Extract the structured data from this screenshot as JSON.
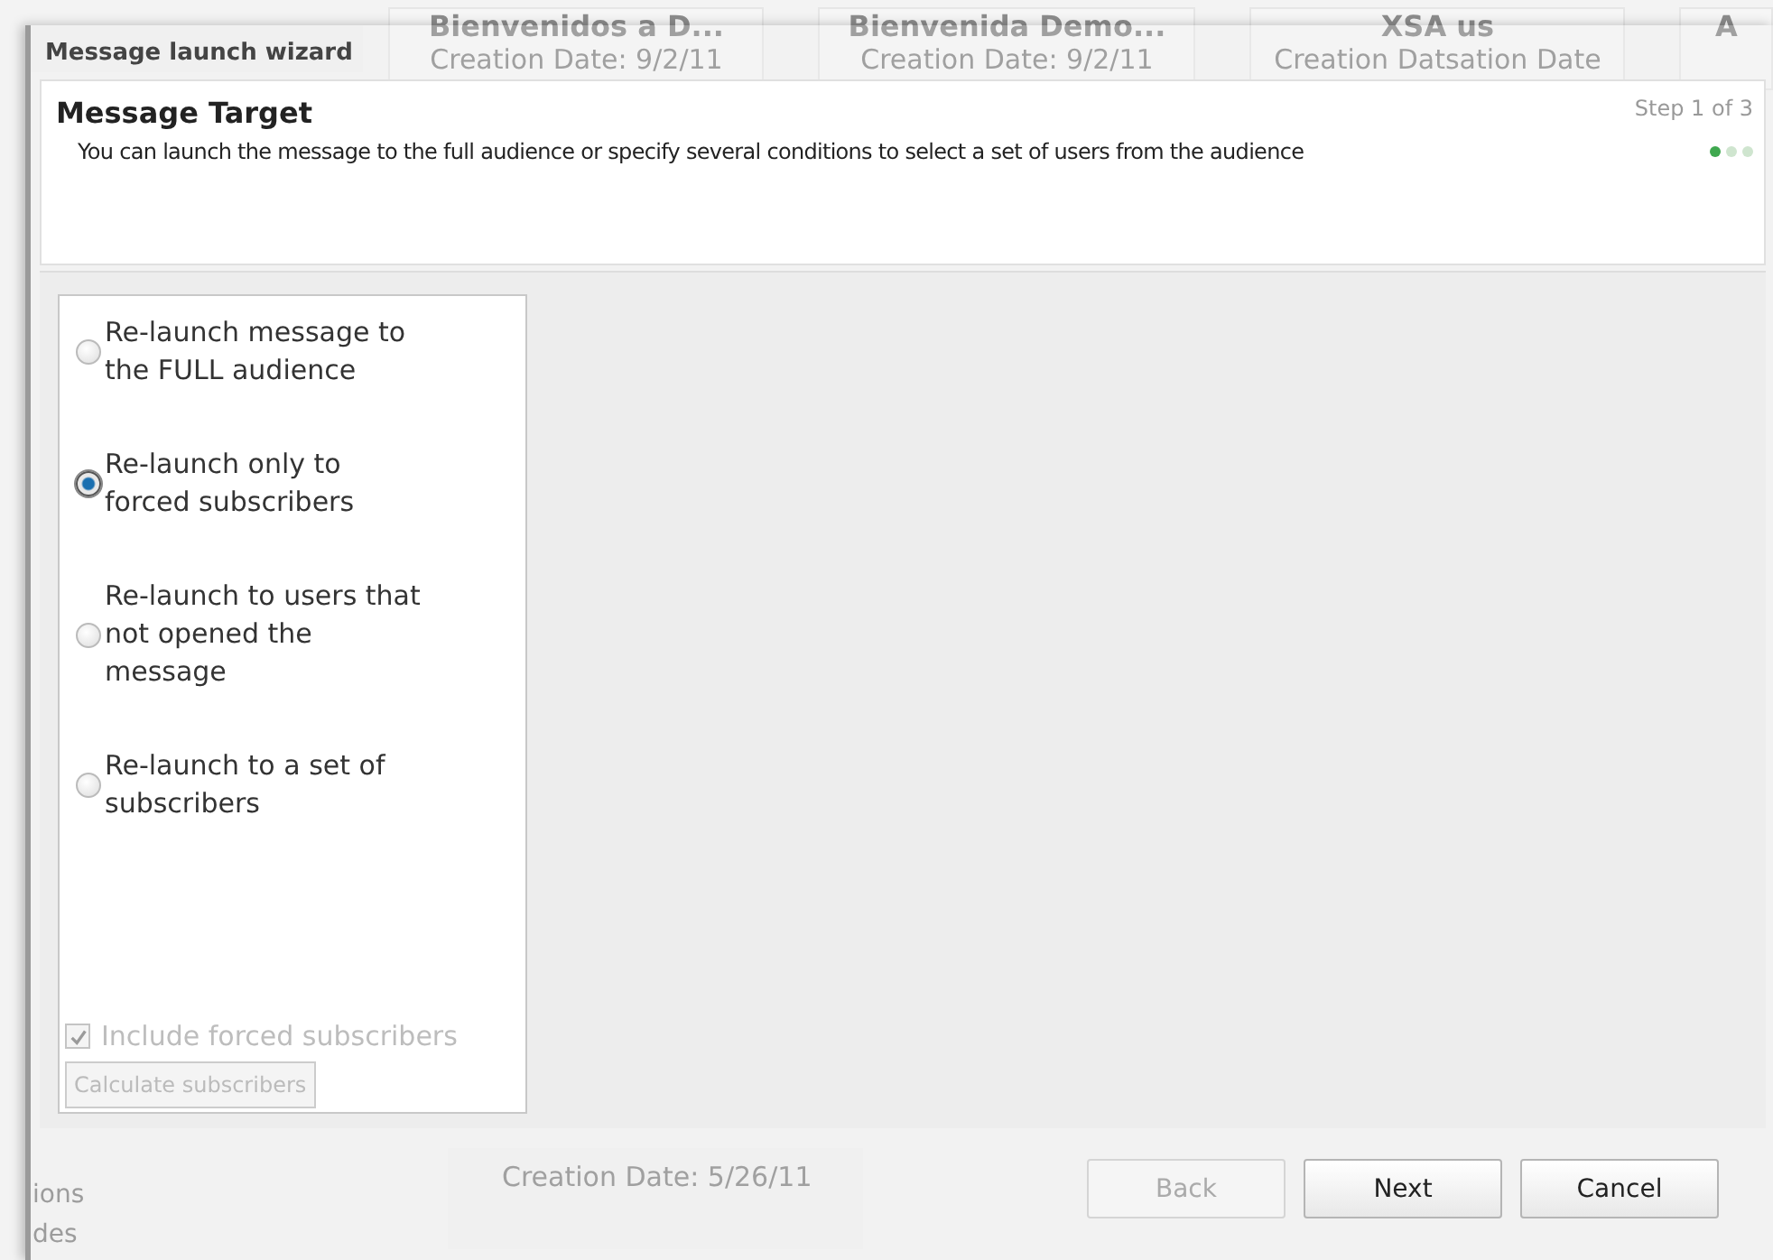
{
  "background": {
    "cards": [
      {
        "title": "Bienvenidos a D...",
        "date": "Creation Date: 9/2/11"
      },
      {
        "title": "Bienvenida Demo...",
        "date": "Creation Date: 9/2/11"
      },
      {
        "title": "XSA us",
        "date": "Creation Datsation Date"
      },
      {
        "title": "A"
      }
    ],
    "lower_card_date": "Creation Date: 5/26/11",
    "sidebar_items": [
      "ions",
      "des"
    ]
  },
  "window": {
    "title": "Message launch wizard"
  },
  "header": {
    "title": "Message Target",
    "description": "You can launch the message to the full audience or specify several conditions to select a set of users from the audience",
    "step": "Step 1 of 3",
    "steps": [
      {
        "selected": true
      },
      {
        "selected": false
      },
      {
        "selected": false
      }
    ]
  },
  "options": [
    {
      "label": "Re-launch message to the FULL audience",
      "selected": false
    },
    {
      "label": "Re-launch only to forced subscribers",
      "selected": true
    },
    {
      "label": "Re-launch to users that not opened the message",
      "selected": false
    },
    {
      "label": "Re-launch to a set of subscribers",
      "selected": false
    }
  ],
  "include_forced": {
    "label": "Include forced subscribers",
    "checked": true,
    "disabled": true
  },
  "calculate_button": {
    "label": "Calculate subscribers",
    "disabled": true
  },
  "buttons": [
    {
      "label": "Back",
      "disabled": true
    },
    {
      "label": "Next",
      "disabled": false
    },
    {
      "label": "Cancel",
      "disabled": false
    }
  ]
}
